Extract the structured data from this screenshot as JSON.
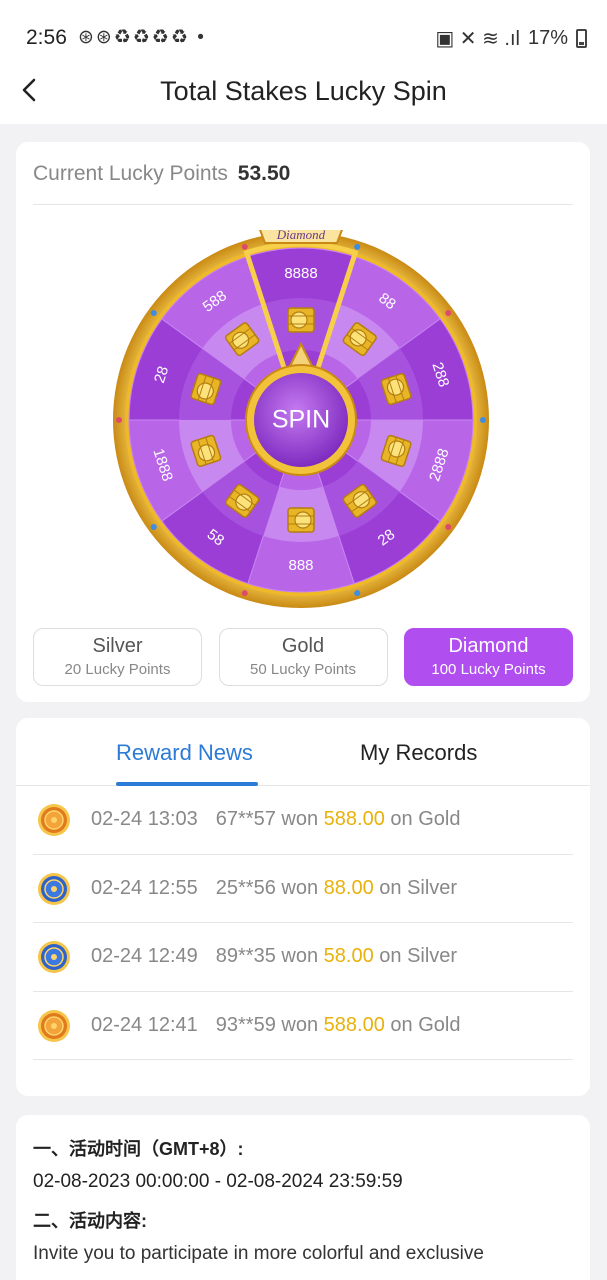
{
  "status_bar": {
    "time": "2:56",
    "left_icons": "⊛⊛♻♻♻♻ •",
    "right_icons": "▣ ✕ ≋ .ıl",
    "battery": "17%"
  },
  "header": {
    "title": "Total Stakes Lucky Spin",
    "back_icon": "chevron-left-icon"
  },
  "wheel_card": {
    "points_label": "Current Lucky Points",
    "points_value": "53.50",
    "tier_banner": "Diamond",
    "spin_label": "SPIN",
    "segments": [
      "8888",
      "88",
      "288",
      "2888",
      "28",
      "888",
      "58",
      "1888",
      "28",
      "588"
    ],
    "colors": {
      "primary": "#9b3ed6",
      "light": "#b865e8",
      "gold": "#f5c518",
      "accent": "#b04ef0"
    }
  },
  "tiers": [
    {
      "name": "Silver",
      "points": "20 Lucky Points",
      "active": false
    },
    {
      "name": "Gold",
      "points": "50 Lucky Points",
      "active": false
    },
    {
      "name": "Diamond",
      "points": "100 Lucky Points",
      "active": true
    }
  ],
  "news_card": {
    "tabs": [
      "Reward News",
      "My Records"
    ],
    "rows": [
      {
        "coin": "gold-coin-icon",
        "datetime": "02-24 13:03",
        "user": "67**57",
        "won": "won",
        "amount": "588.00",
        "on": "on Gold"
      },
      {
        "coin": "silver-coin-icon",
        "datetime": "02-24 12:55",
        "user": "25**56",
        "won": "won",
        "amount": "88.00",
        "on": "on Silver"
      },
      {
        "coin": "silver-coin-icon",
        "datetime": "02-24 12:49",
        "user": "89**35",
        "won": "won",
        "amount": "58.00",
        "on": "on Silver"
      },
      {
        "coin": "gold-coin-icon",
        "datetime": "02-24 12:41",
        "user": "93**59",
        "won": "won",
        "amount": "588.00",
        "on": "on Gold"
      }
    ]
  },
  "info": {
    "line1": "一、活动时间（GMT+8）:",
    "line2": "02-08-2023 00:00:00 - 02-08-2024 23:59:59",
    "line3": "二、活动内容:",
    "line4": "Invite you to participate in more colorful and exclusive"
  }
}
